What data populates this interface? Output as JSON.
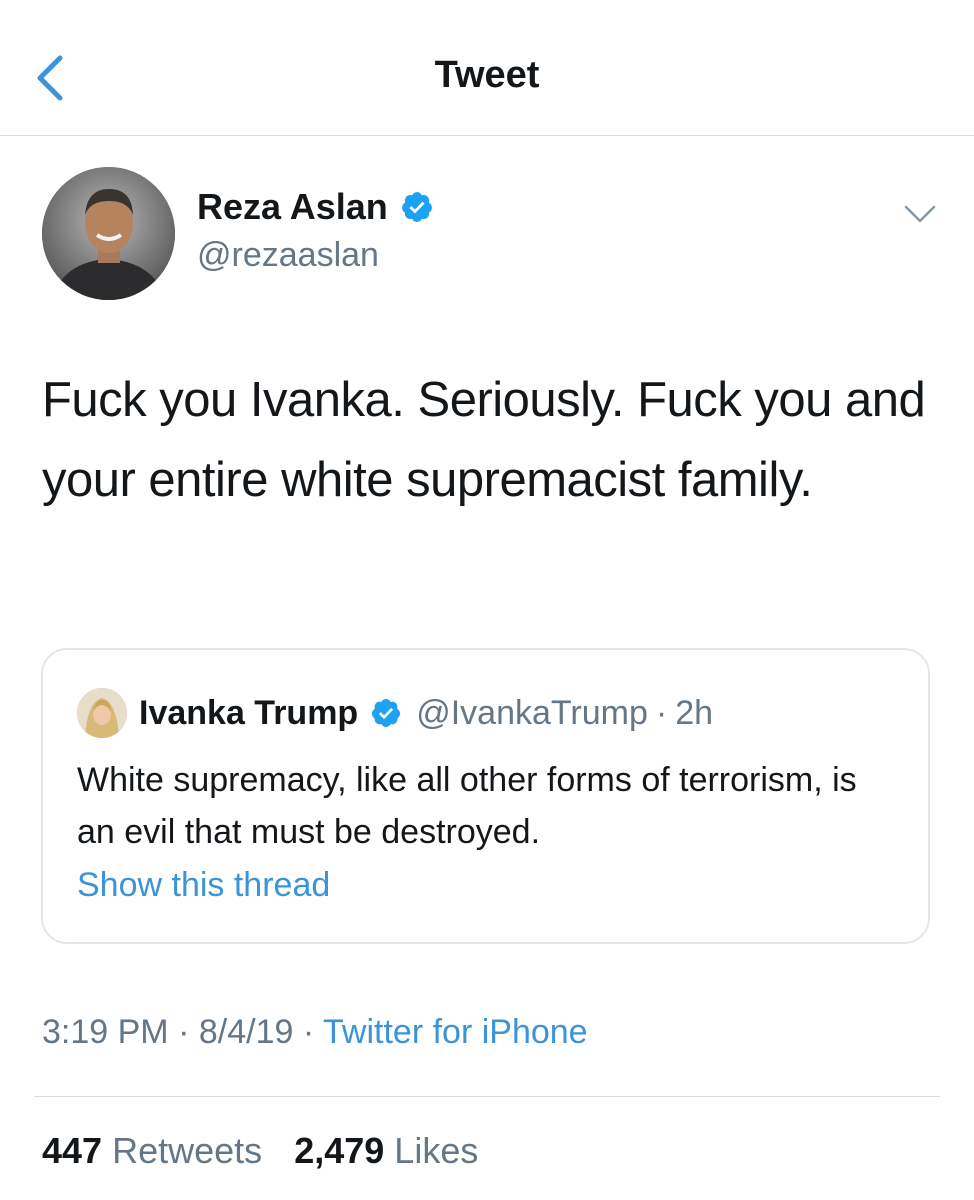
{
  "header": {
    "title": "Tweet",
    "back_icon": "chevron-left-icon"
  },
  "author": {
    "name": "Reza Aslan",
    "handle": "@rezaaslan",
    "verified": true
  },
  "tweet": {
    "text": "Fuck you Ivanka. Seriously. Fuck you and your entire white supremacist family."
  },
  "quote": {
    "name": "Ivanka Trump",
    "handle": "@IvankaTrump",
    "separator": "·",
    "time": "2h",
    "text": "White supremacy, like all other forms of terrorism, is an evil that must be destroyed.",
    "show_thread": "Show this thread"
  },
  "meta": {
    "time": "3:19 PM",
    "date": "8/4/19",
    "separator": "·",
    "source": "Twitter for iPhone"
  },
  "stats": {
    "retweets_count": "447",
    "retweets_label": "Retweets",
    "likes_count": "2,479",
    "likes_label": "Likes"
  },
  "colors": {
    "accent": "#3b94d9",
    "text": "#14171a",
    "secondary": "#657786",
    "border": "#e1e8ed"
  }
}
